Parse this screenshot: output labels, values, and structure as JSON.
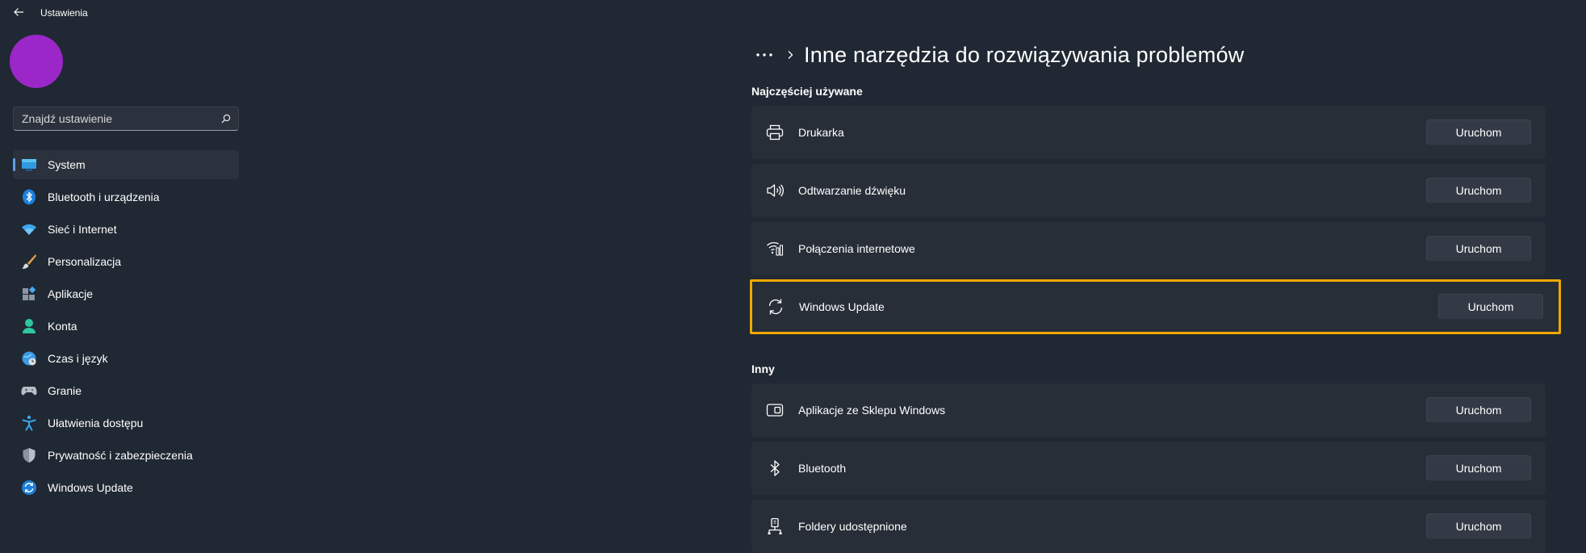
{
  "app": {
    "title": "Ustawienia"
  },
  "search": {
    "placeholder": "Znajdź ustawienie"
  },
  "sidebar": {
    "items": [
      {
        "label": "System",
        "icon": "system-icon",
        "selected": true
      },
      {
        "label": "Bluetooth i urządzenia",
        "icon": "bluetooth-icon"
      },
      {
        "label": "Sieć i Internet",
        "icon": "wifi-icon"
      },
      {
        "label": "Personalizacja",
        "icon": "brush-icon"
      },
      {
        "label": "Aplikacje",
        "icon": "apps-icon"
      },
      {
        "label": "Konta",
        "icon": "account-icon"
      },
      {
        "label": "Czas i język",
        "icon": "time-language-icon"
      },
      {
        "label": "Granie",
        "icon": "gamepad-icon"
      },
      {
        "label": "Ułatwienia dostępu",
        "icon": "accessibility-icon"
      },
      {
        "label": "Prywatność i zabezpieczenia",
        "icon": "shield-icon"
      },
      {
        "label": "Windows Update",
        "icon": "windows-update-icon"
      }
    ]
  },
  "page": {
    "title": "Inne narzędzia do rozwiązywania problemów"
  },
  "sections": [
    {
      "title": "Najczęściej używane",
      "items": [
        {
          "label": "Drukarka",
          "icon": "printer-icon",
          "button": "Uruchom"
        },
        {
          "label": "Odtwarzanie dźwięku",
          "icon": "speaker-icon",
          "button": "Uruchom"
        },
        {
          "label": "Połączenia internetowe",
          "icon": "internet-connection-icon",
          "button": "Uruchom"
        },
        {
          "label": "Windows Update",
          "icon": "sync-icon",
          "button": "Uruchom",
          "highlighted": true
        }
      ]
    },
    {
      "title": "Inny",
      "items": [
        {
          "label": "Aplikacje ze Sklepu Windows",
          "icon": "store-app-icon",
          "button": "Uruchom"
        },
        {
          "label": "Bluetooth",
          "icon": "bluetooth-icon",
          "button": "Uruchom"
        },
        {
          "label": "Foldery udostępnione",
          "icon": "shared-folder-icon",
          "button": "Uruchom"
        }
      ]
    }
  ],
  "colors": {
    "background": "#202833",
    "card": "#272e38",
    "accent": "#5ea0e8",
    "highlight": "#f0a800",
    "avatar": "#9b27c8"
  }
}
